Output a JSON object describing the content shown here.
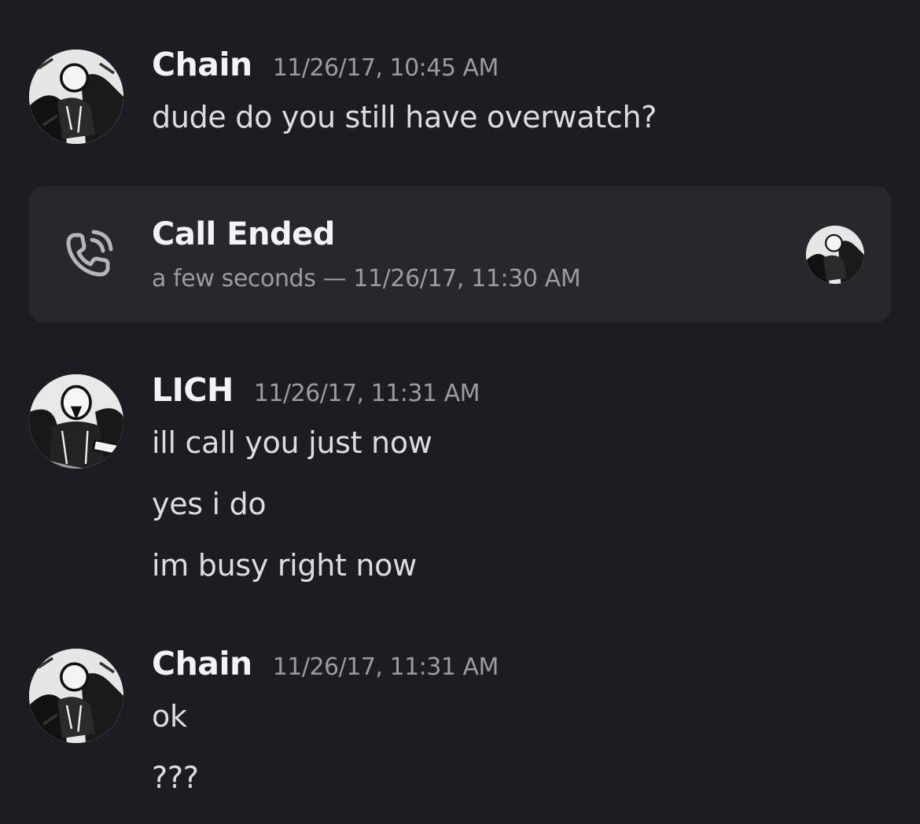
{
  "messages": [
    {
      "author": "Chain",
      "timestamp": "11/26/17, 10:45 AM",
      "lines": [
        "dude do you still have overwatch?"
      ]
    },
    {
      "author": "LICH",
      "timestamp": "11/26/17, 11:31 AM",
      "lines": [
        "ill call you just now",
        "yes i do",
        "im busy right now"
      ]
    },
    {
      "author": "Chain",
      "timestamp": "11/26/17, 11:31 AM",
      "lines": [
        "ok",
        "???"
      ]
    }
  ],
  "call": {
    "title": "Call Ended",
    "meta": "a few seconds — 11/26/17, 11:30 AM",
    "icon": "phone-call-icon"
  },
  "colors": {
    "background": "#1c1d22",
    "card": "#27282e",
    "username": "#f2f3f5",
    "text": "#dcdde0",
    "muted": "#9a9ca4"
  }
}
